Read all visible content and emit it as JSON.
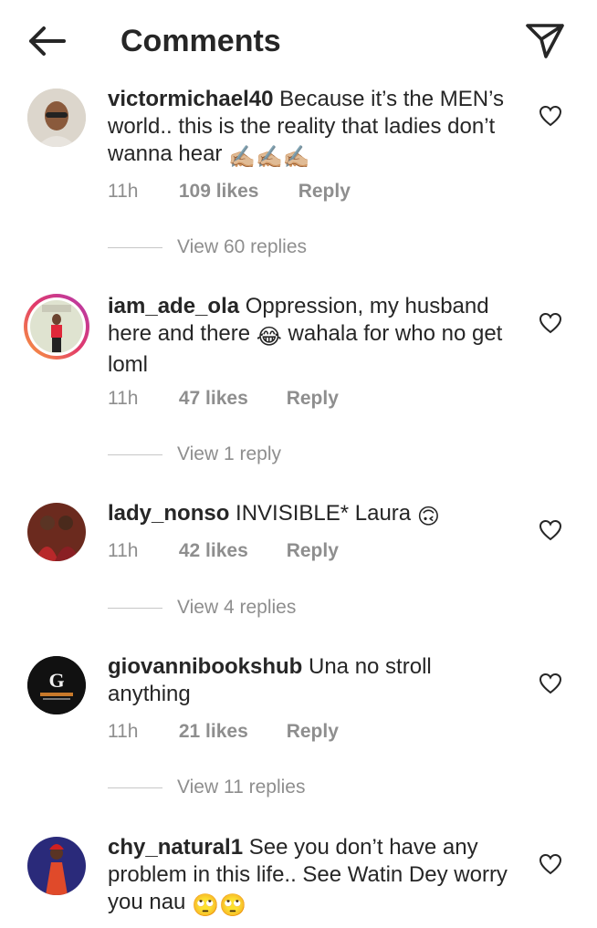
{
  "header": {
    "title": "Comments"
  },
  "comments": [
    {
      "user": "victormichael40",
      "text": "Because it’s the MEN’s world.. this is the reality that ladies don’t wanna hear",
      "emoji": "✍🏼✍🏼✍🏼",
      "time": "11h",
      "likes": "109 likes",
      "reply": "Reply",
      "view_replies": "View 60 replies"
    },
    {
      "user": "iam_ade_ola",
      "text": "Oppression, my husband here and there",
      "emoji": "😂",
      "text_after": "wahala for who no get loml",
      "time": "11h",
      "likes": "47 likes",
      "reply": "Reply",
      "view_replies": "View 1 reply"
    },
    {
      "user": "lady_nonso",
      "text": "INVISIBLE* Laura",
      "emoji": "🙃",
      "time": "11h",
      "likes": "42 likes",
      "reply": "Reply",
      "view_replies": "View 4 replies"
    },
    {
      "user": "giovannibookshub",
      "text": "Una no stroll anything",
      "time": "11h",
      "likes": "21 likes",
      "reply": "Reply",
      "view_replies": "View 11 replies"
    },
    {
      "user": "chy_natural1",
      "text": "See you don’t have any problem in this life.. See Watin Dey worry you nau",
      "emoji": "🙄🙄"
    }
  ]
}
